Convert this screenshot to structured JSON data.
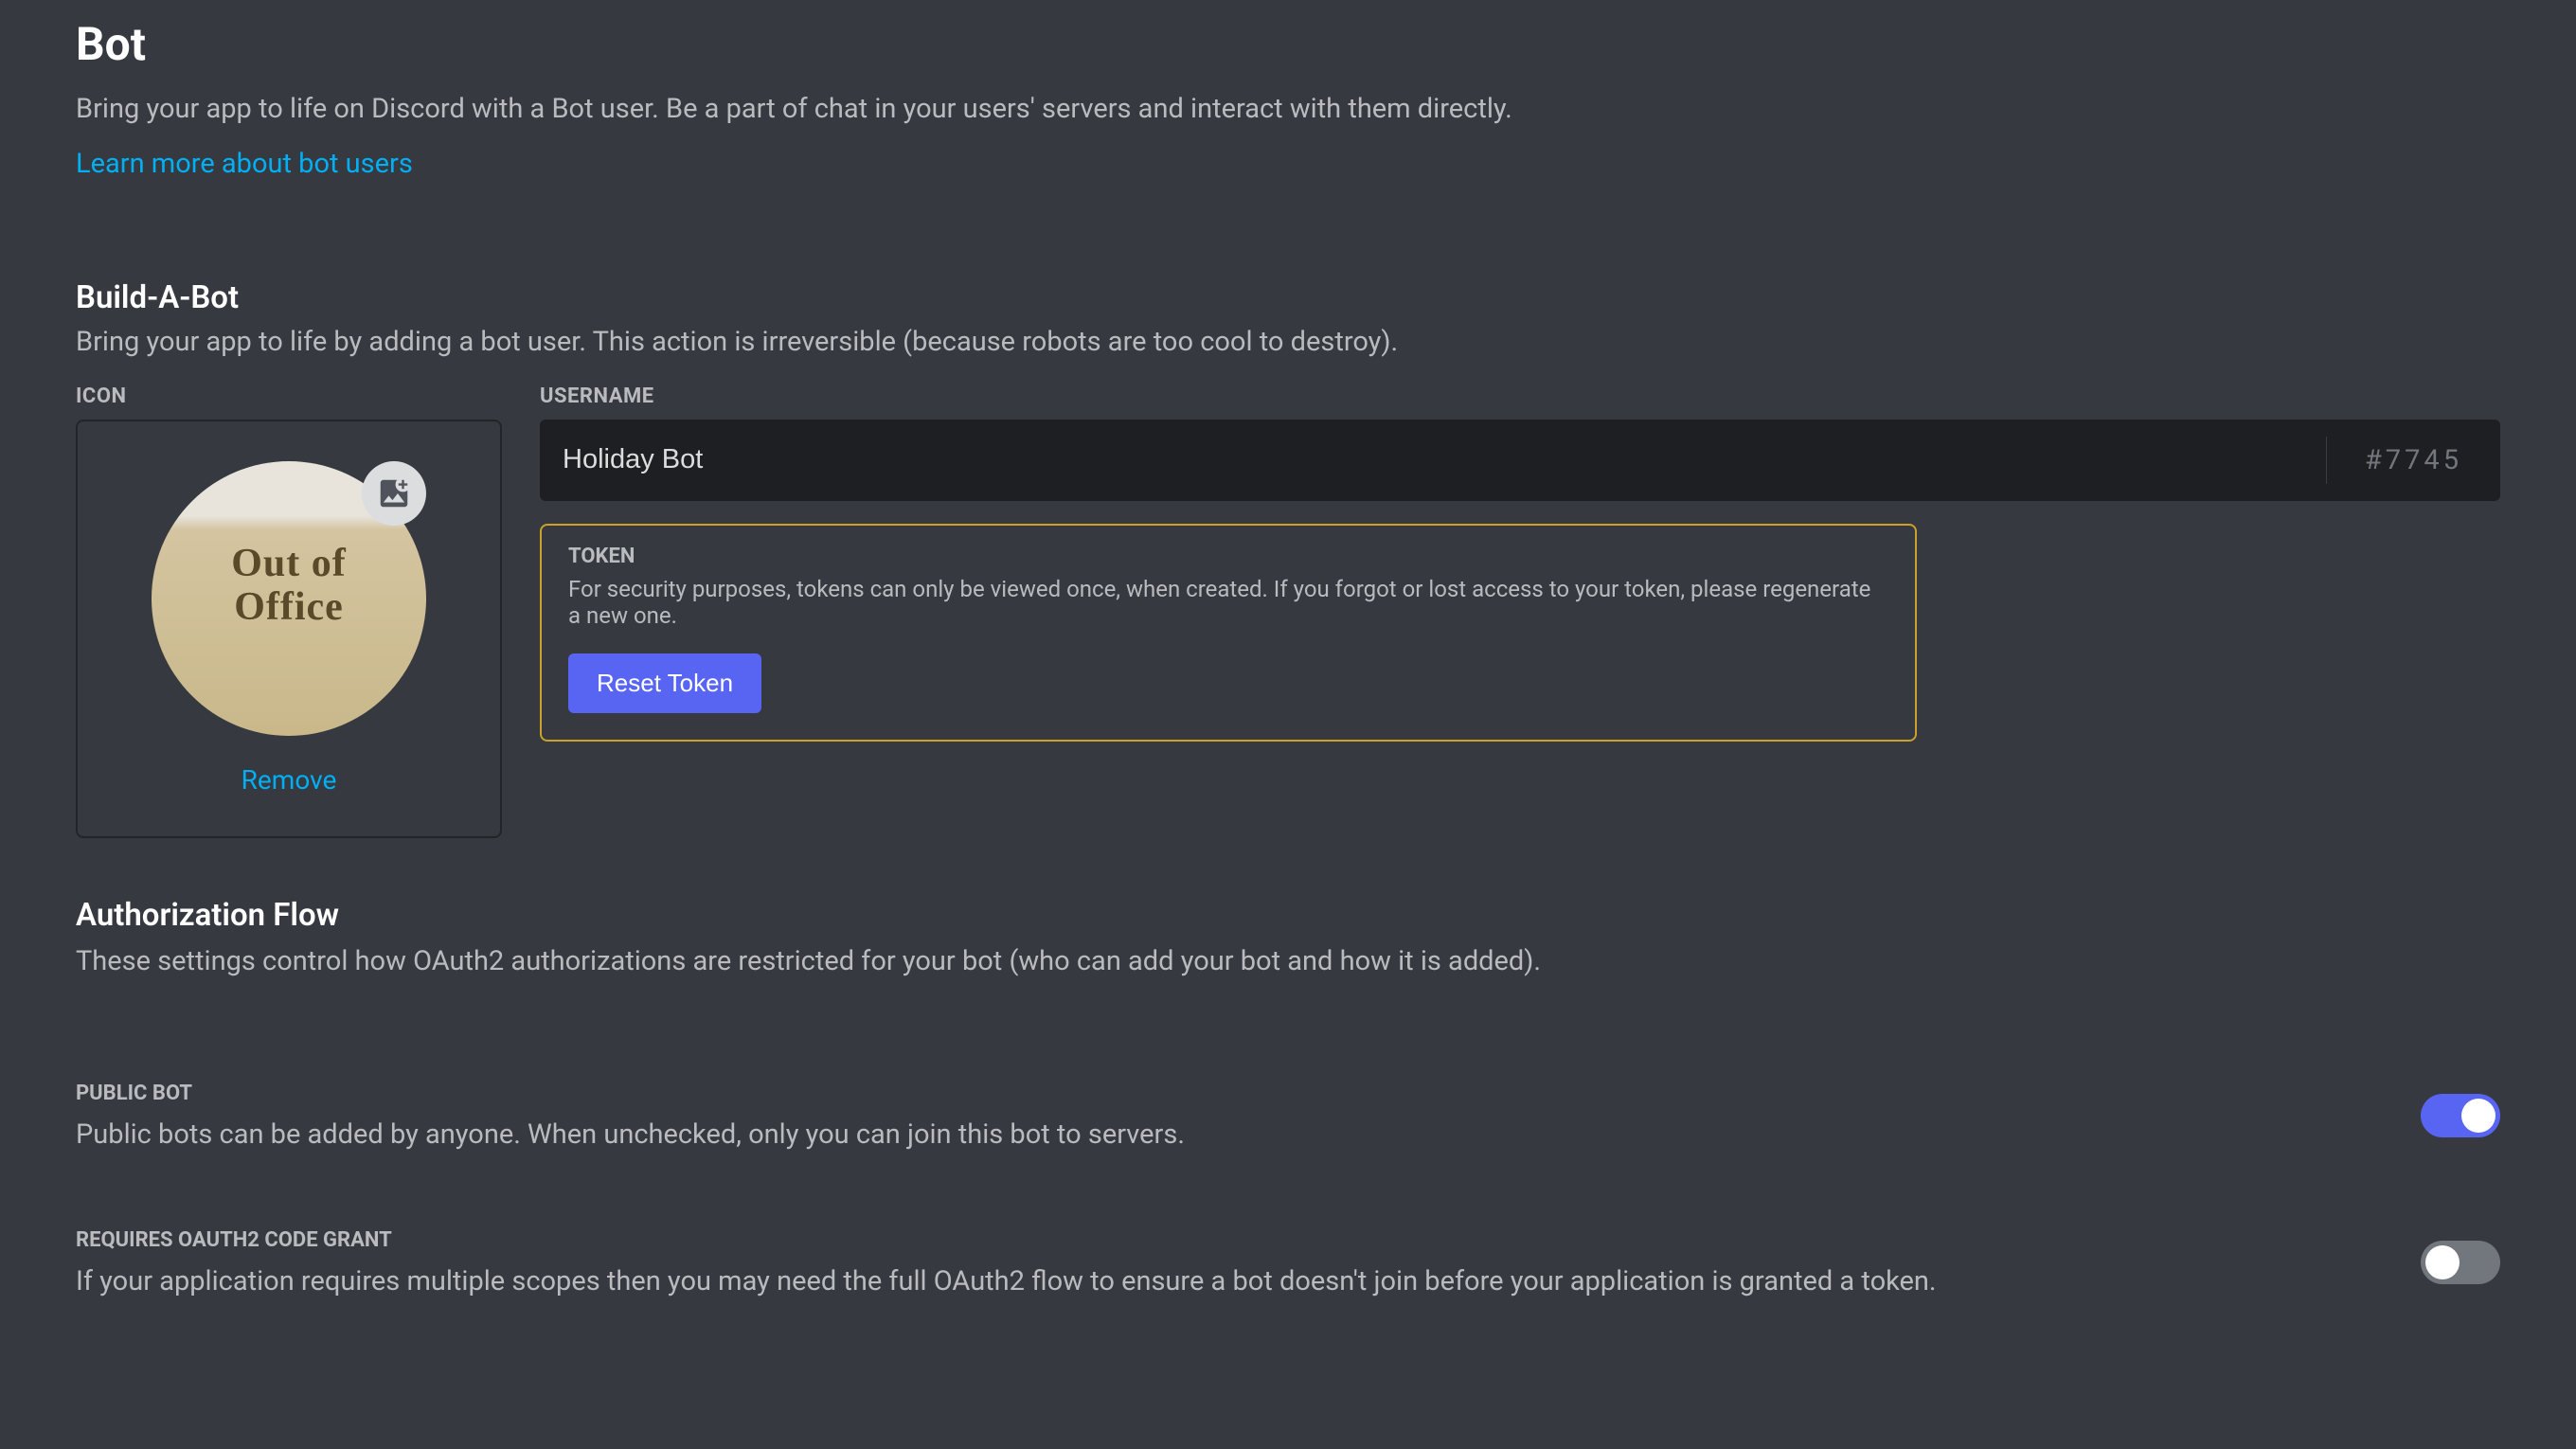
{
  "header": {
    "title": "Bot",
    "subtitle": "Bring your app to life on Discord with a Bot user. Be a part of chat in your users' servers and interact with them directly.",
    "learn_more": "Learn more about bot users"
  },
  "build_bot": {
    "title": "Build-A-Bot",
    "description": "Bring your app to life by adding a bot user. This action is irreversible (because robots are too cool to destroy).",
    "icon_label": "Icon",
    "avatar_text": "Out of Office",
    "remove_label": "Remove",
    "username_label": "Username",
    "username_value": "Holiday Bot",
    "discriminator": "#7745"
  },
  "token": {
    "label": "Token",
    "description": "For security purposes, tokens can only be viewed once, when created. If you forgot or lost access to your token, please regenerate a new one.",
    "reset_button": "Reset Token"
  },
  "auth_flow": {
    "title": "Authorization Flow",
    "description": "These settings control how OAuth2 authorizations are restricted for your bot (who can add your bot and how it is added)."
  },
  "public_bot": {
    "label": "Public Bot",
    "description": "Public bots can be added by anyone. When unchecked, only you can join this bot to servers.",
    "enabled": true
  },
  "oauth_grant": {
    "label": "Requires OAuth2 Code Grant",
    "description": "If your application requires multiple scopes then you may need the full OAuth2 flow to ensure a bot doesn't join before your application is granted a token.",
    "enabled": false
  }
}
